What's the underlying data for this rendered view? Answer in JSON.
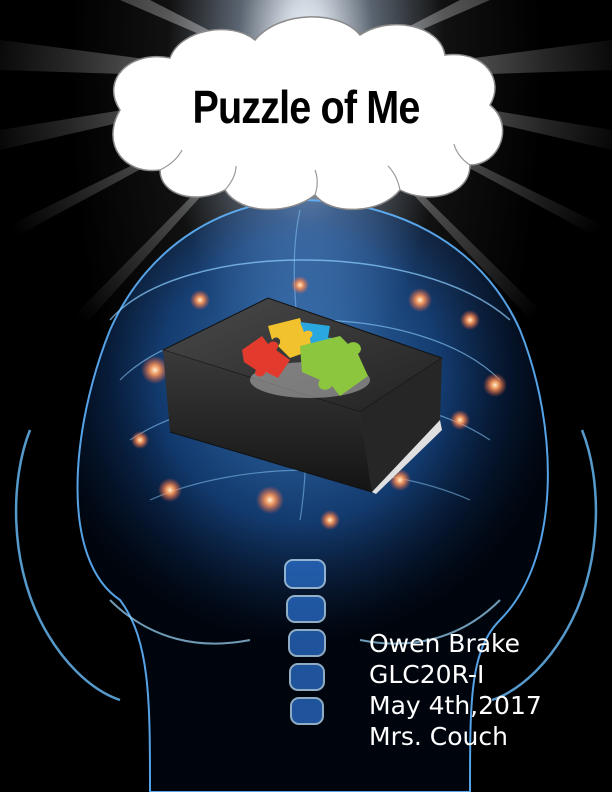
{
  "cover": {
    "title": "Puzzle of Me",
    "author": "Owen Brake",
    "course": "GLC20R-I",
    "date": "May 4th,2017",
    "teacher": "Mrs. Couch"
  },
  "colors": {
    "background": "#000000",
    "brain_glow": "#1e78ff",
    "cloud_fill": "#ffffff",
    "box": "#2a2a2a",
    "puzzle_red": "#e23b2e",
    "puzzle_yellow": "#f2c12e",
    "puzzle_blue": "#29a8e0",
    "puzzle_green": "#8cc63f"
  },
  "icons": [
    "thought-cloud",
    "brain-head-xray",
    "shoe-box",
    "puzzle-pieces"
  ]
}
